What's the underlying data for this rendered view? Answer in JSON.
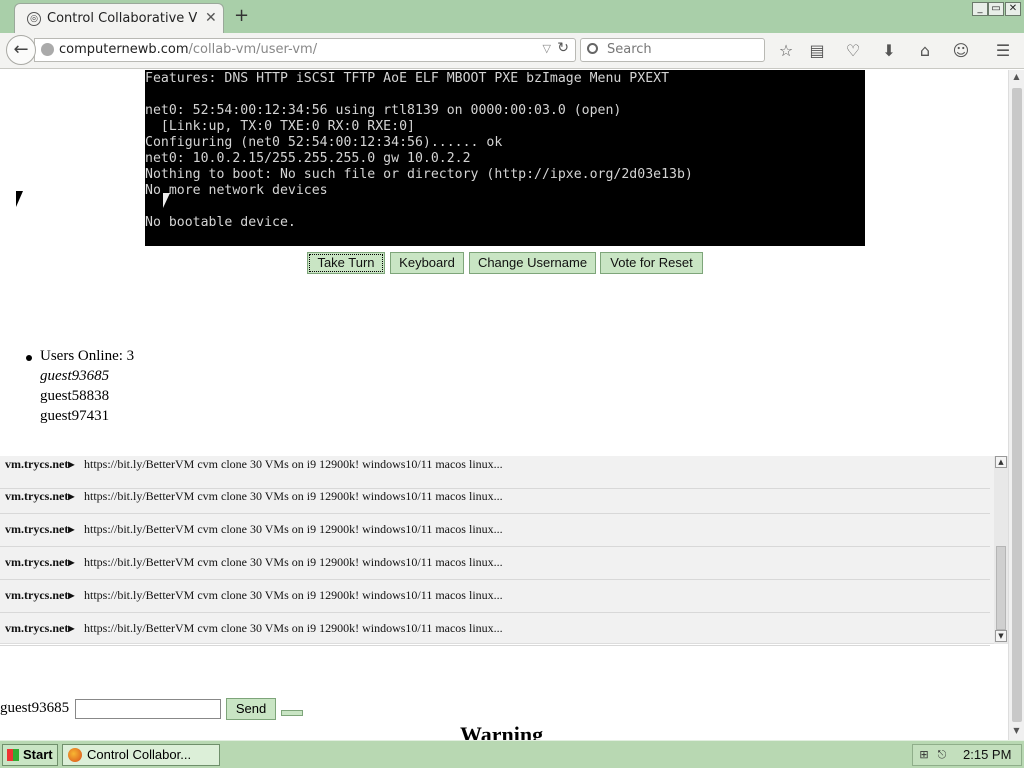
{
  "browser": {
    "tab_title": "Control Collaborative Vir...",
    "tab_close": "✕",
    "new_tab": "+",
    "window_controls": {
      "minimize": "_",
      "maximize": "▭",
      "close": "✕"
    },
    "url_domain": "computernewb.com",
    "url_path": "/collab-vm/user-vm/",
    "search_placeholder": "Search",
    "toolbar_icons": [
      "bookmark-star-icon",
      "reading-list-icon",
      "pocket-icon",
      "download-icon",
      "home-icon",
      "chat-icon",
      "menu-icon"
    ]
  },
  "vm": {
    "console_text": "Features: DNS HTTP iSCSI TFTP AoE ELF MBOOT PXE bzImage Menu PXEXT\n\nnet0: 52:54:00:12:34:56 using rtl8139 on 0000:00:03.0 (open)\n  [Link:up, TX:0 TXE:0 RX:0 RXE:0]\nConfiguring (net0 52:54:00:12:34:56)...... ok\nnet0: 10.0.2.15/255.255.255.0 gw 10.0.2.2\nNothing to boot: No such file or directory (http://ipxe.org/2d03e13b)\nNo more network devices\n\nNo bootable device.",
    "buttons": {
      "take_turn": "Take Turn",
      "keyboard": "Keyboard",
      "change_username": "Change Username",
      "vote_reset": "Vote for Reset"
    }
  },
  "users": {
    "online_label": "Users Online: 3",
    "list": [
      "guest93685",
      "guest58838",
      "guest97431"
    ]
  },
  "chat": {
    "messages": [
      {
        "nick": "vm.trycs.net▸",
        "text": "https://bit.ly/BetterVM cvm clone 30 VMs on i9 12900k! windows10/11 macos linux..."
      },
      {
        "nick": "vm.trycs.net▸",
        "text": "https://bit.ly/BetterVM cvm clone 30 VMs on i9 12900k! windows10/11 macos linux..."
      },
      {
        "nick": "vm.trycs.net▸",
        "text": "https://bit.ly/BetterVM cvm clone 30 VMs on i9 12900k! windows10/11 macos linux..."
      },
      {
        "nick": "vm.trycs.net▸",
        "text": "https://bit.ly/BetterVM cvm clone 30 VMs on i9 12900k! windows10/11 macos linux..."
      },
      {
        "nick": "vm.trycs.net▸",
        "text": "https://bit.ly/BetterVM cvm clone 30 VMs on i9 12900k! windows10/11 macos linux..."
      },
      {
        "nick": "vm.trycs.net▸",
        "text": "https://bit.ly/BetterVM cvm clone 30 VMs on i9 12900k! windows10/11 macos linux..."
      }
    ],
    "username": "guest93685",
    "input_value": "",
    "send_label": "Send"
  },
  "warning_heading": "Warning",
  "taskbar": {
    "start_label": "Start",
    "task_label": "Control Collabor...",
    "clock": "2:15 PM"
  },
  "colors": {
    "chrome_green": "#a9cfa9",
    "button_green": "#c9e5c4",
    "taskbar_green": "#b8d8b2",
    "console_bg": "#000000"
  }
}
